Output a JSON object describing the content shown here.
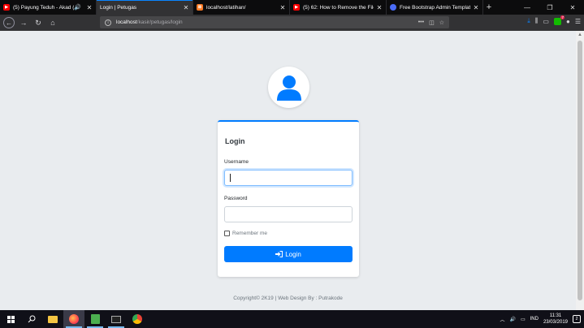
{
  "browser": {
    "tabs": [
      {
        "title": "(5) Payung Teduh - Akad (c",
        "favicon": "youtube-icon",
        "audio": true,
        "active": false
      },
      {
        "title": "Login | Petugas",
        "favicon": "",
        "audio": false,
        "active": true
      },
      {
        "title": "localhost/latihan/",
        "favicon": "xampp-icon",
        "audio": false,
        "active": false
      },
      {
        "title": "(5) 62: How to Remove the File",
        "favicon": "youtube-icon",
        "audio": false,
        "active": false
      },
      {
        "title": "Free Bootstrap Admin Templat",
        "favicon": "site-icon",
        "audio": false,
        "active": false
      }
    ],
    "url_host": "localhost",
    "url_path": "/kasir/petugas/login",
    "ext_badge": "7"
  },
  "login": {
    "title": "Login",
    "username_label": "Username",
    "username_value": "",
    "password_label": "Password",
    "password_value": "",
    "remember_label": "Remember me",
    "remember_checked": false,
    "button_label": "Login"
  },
  "footer": {
    "text": "Copyright© 2K19 | Web Design By : Putrakode"
  },
  "taskbar": {
    "lang": "IND",
    "time": "11:31",
    "date": "23/03/2019",
    "notif_count": "2"
  },
  "colors": {
    "primary": "#007bff",
    "page_bg": "#e9ecef"
  }
}
